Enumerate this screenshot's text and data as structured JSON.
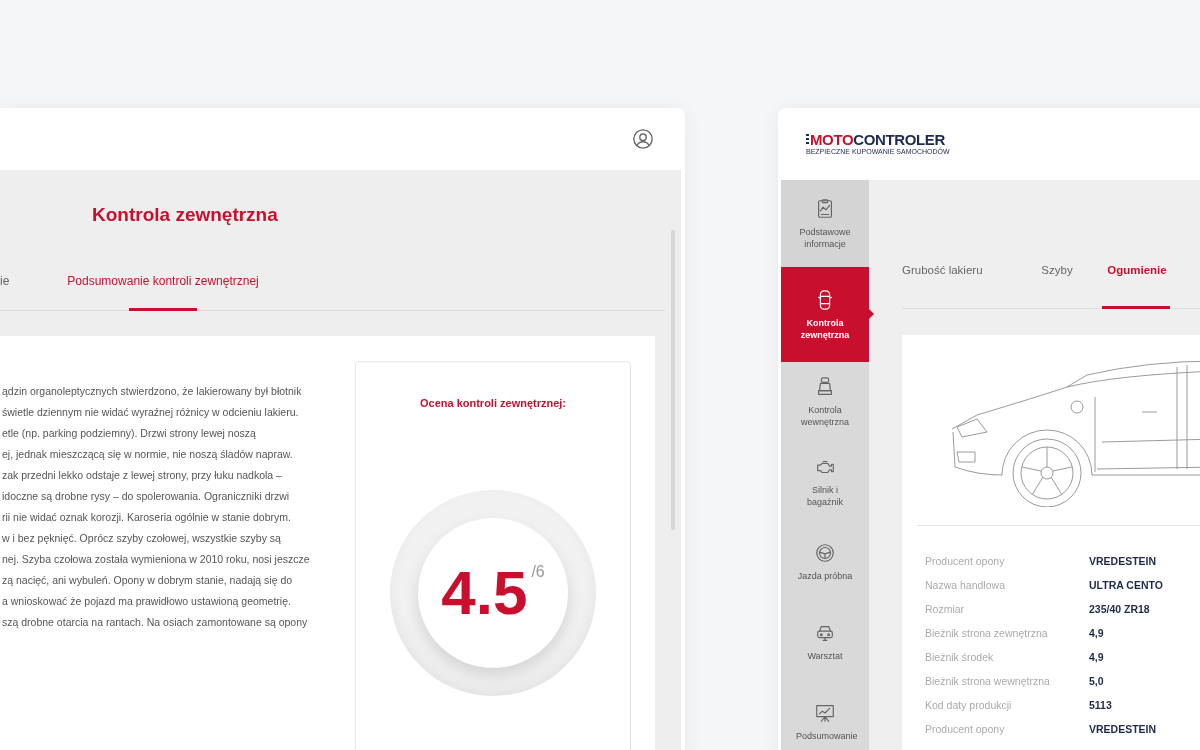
{
  "left_window": {
    "title": "Kontrola zewnętrzna",
    "tabs": [
      {
        "label": "ie",
        "selected": false
      },
      {
        "label": "Podsumowanie kontroli zewnętrznej",
        "selected": true
      }
    ],
    "summary_lines": [
      "ądzin organoleptycznych stwierdzono, że lakierowany był błotnik",
      "świetle dziennym nie widać wyraźnej różnicy w odcieniu lakieru.",
      "etle (np. parking podziemny). Drzwi strony lewej noszą",
      "ej, jednak mieszczącą się w normie, nie noszą śladów napraw.",
      "zak przedni lekko odstaje z lewej strony, przy łuku nadkola –",
      "idoczne są drobne rysy – do spolerowania. Ograniczniki drzwi",
      "rii nie widać oznak korozji. Karoseria ogólnie w stanie dobrym.",
      "w i bez pęknięć. Oprócz szyby czołowej, wszystkie szyby są",
      "nej. Szyba czołowa została wymieniona w 2010 roku, nosi jeszcze",
      "zą nacięć, ani wybuleń. Opony w dobrym stanie, nadają się do",
      "a wnioskować że pojazd ma prawidłowo ustawioną geometrię.",
      "szą drobne otarcia na rantach. Na osiach zamontowane są opony"
    ],
    "score": {
      "label": "Ocena kontroli zewnętrznej:",
      "value": "4.5",
      "max": "/6"
    }
  },
  "right_window": {
    "logo": {
      "brand_red": "MOTO",
      "brand_dark": "CONTROLER",
      "tagline": "BEZPIECZNE KUPOWANIE SAMOCHODÓW"
    },
    "sidebar": [
      {
        "label": "Podstawowe informacje",
        "selected": false
      },
      {
        "label": "Kontrola zewnętrzna",
        "selected": true
      },
      {
        "label": "Kontrola wewnętrzna",
        "selected": false
      },
      {
        "label": "Silnik i bagażnik",
        "selected": false
      },
      {
        "label": "Jazda próbna",
        "selected": false
      },
      {
        "label": "Warsztat",
        "selected": false
      },
      {
        "label": "Podsumowanie",
        "selected": false
      }
    ],
    "tabs": [
      {
        "label": "Grubość lakieru",
        "selected": false
      },
      {
        "label": "Szyby",
        "selected": false
      },
      {
        "label": "Ogumienie",
        "selected": true
      }
    ],
    "tire_details": [
      {
        "label": "Producent opony",
        "value": "VREDESTEIN"
      },
      {
        "label": "Nazwa handlowa",
        "value": "ULTRA CENTO"
      },
      {
        "label": "Rozmiar",
        "value": "235/40 ZR18"
      },
      {
        "label": "Bieżnik strona zewnętrzna",
        "value": "4,9"
      },
      {
        "label": "Bieżnik środek",
        "value": "4,9"
      },
      {
        "label": "Bieżnik strona wewnętrzna",
        "value": "5,0"
      },
      {
        "label": "Kod daty produkcji",
        "value": "5113"
      },
      {
        "label": "Producent opony",
        "value": "VREDESTEIN"
      }
    ]
  }
}
